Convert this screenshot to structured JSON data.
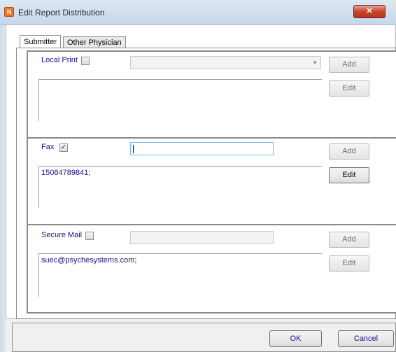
{
  "window": {
    "title": "Edit Report Distribution",
    "close_glyph": "✕",
    "app_icon_glyph": "N"
  },
  "tabs": [
    {
      "label": "Submitter",
      "active": true
    },
    {
      "label": "Other Physician",
      "active": false
    }
  ],
  "sections": {
    "local_print": {
      "label": "Local Print",
      "checked": false,
      "combo_value": "",
      "list_items": [],
      "add_label": "Add",
      "edit_label": "Edit"
    },
    "fax": {
      "label": "Fax",
      "checked": true,
      "check_glyph": "✓",
      "input_value": "",
      "list_items": [
        "15084789841;"
      ],
      "add_label": "Add",
      "edit_label": "Edit"
    },
    "secure_mail": {
      "label": "Secure Mail",
      "checked": false,
      "input_value": "",
      "list_items": [
        "suec@psychesystems.com;"
      ],
      "add_label": "Add",
      "edit_label": "Edit"
    }
  },
  "footer": {
    "ok_label": "OK",
    "cancel_label": "Cancel"
  },
  "icons": {
    "app": "app-logo-icon",
    "close": "close-icon",
    "combo": "chevron-down-icon",
    "check": "checkmark-icon"
  },
  "colors": {
    "label_text": "#17157a",
    "close_button": "#c7432a",
    "titlebar": "#c6d7ea"
  }
}
